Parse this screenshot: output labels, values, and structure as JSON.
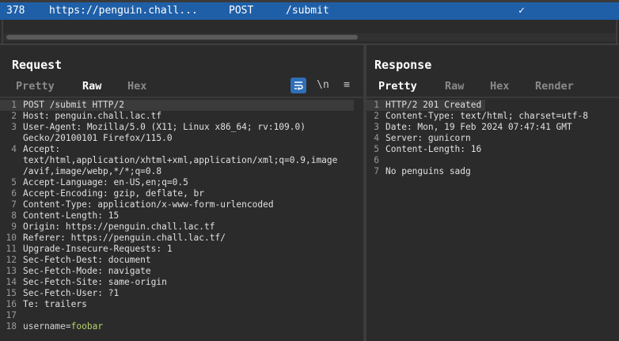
{
  "history": {
    "row": {
      "num": "378",
      "url": "https://penguin.chall...",
      "method": "POST",
      "path": "/submit",
      "check": "✓"
    }
  },
  "request": {
    "title": "Request",
    "tabs": [
      "Pretty",
      "Raw",
      "Hex"
    ],
    "active_tab": "Raw",
    "icons": [
      "wrap-lines-icon",
      "newline-icon",
      "menu-icon"
    ],
    "icon_glyphs": {
      "newline": "\\n",
      "menu": "≡"
    },
    "lines": [
      {
        "n": "1",
        "text": "POST /submit HTTP/2"
      },
      {
        "n": "2",
        "text": "Host: penguin.chall.lac.tf"
      },
      {
        "n": "3",
        "text": "User-Agent: Mozilla/5.0 (X11; Linux x86_64; rv:109.0)"
      },
      {
        "n": "",
        "text": "Gecko/20100101 Firefox/115.0"
      },
      {
        "n": "4",
        "text": "Accept:"
      },
      {
        "n": "",
        "text": "text/html,application/xhtml+xml,application/xml;q=0.9,image"
      },
      {
        "n": "",
        "text": "/avif,image/webp,*/*;q=0.8"
      },
      {
        "n": "5",
        "text": "Accept-Language: en-US,en;q=0.5"
      },
      {
        "n": "6",
        "text": "Accept-Encoding: gzip, deflate, br"
      },
      {
        "n": "7",
        "text": "Content-Type: application/x-www-form-urlencoded"
      },
      {
        "n": "8",
        "text": "Content-Length: 15"
      },
      {
        "n": "9",
        "text": "Origin: https://penguin.chall.lac.tf"
      },
      {
        "n": "10",
        "text": "Referer: https://penguin.chall.lac.tf/"
      },
      {
        "n": "11",
        "text": "Upgrade-Insecure-Requests: 1"
      },
      {
        "n": "12",
        "text": "Sec-Fetch-Dest: document"
      },
      {
        "n": "13",
        "text": "Sec-Fetch-Mode: navigate"
      },
      {
        "n": "14",
        "text": "Sec-Fetch-Site: same-origin"
      },
      {
        "n": "15",
        "text": "Sec-Fetch-User: ?1"
      },
      {
        "n": "16",
        "text": "Te: trailers"
      },
      {
        "n": "17",
        "text": ""
      }
    ],
    "body_line": {
      "n": "18",
      "key": "username",
      "eq": "=",
      "value": "foobar"
    }
  },
  "response": {
    "title": "Response",
    "tabs": [
      "Pretty",
      "Raw",
      "Hex",
      "Render"
    ],
    "active_tab": "Pretty",
    "lines": [
      {
        "n": "1",
        "text": "HTTP/2 201 Created"
      },
      {
        "n": "2",
        "text": "Content-Type: text/html; charset=utf-8"
      },
      {
        "n": "3",
        "text": "Date: Mon, 19 Feb 2024 07:47:41 GMT"
      },
      {
        "n": "4",
        "text": "Server: gunicorn"
      },
      {
        "n": "5",
        "text": "Content-Length: 16"
      },
      {
        "n": "6",
        "text": ""
      },
      {
        "n": "7",
        "text": "No penguins sadg"
      }
    ]
  },
  "colors": {
    "selected_row": "#1f5fa8",
    "active_tab_underline": "#e8772e",
    "param_value": "#b5d46b",
    "background": "#2b2b2b"
  }
}
